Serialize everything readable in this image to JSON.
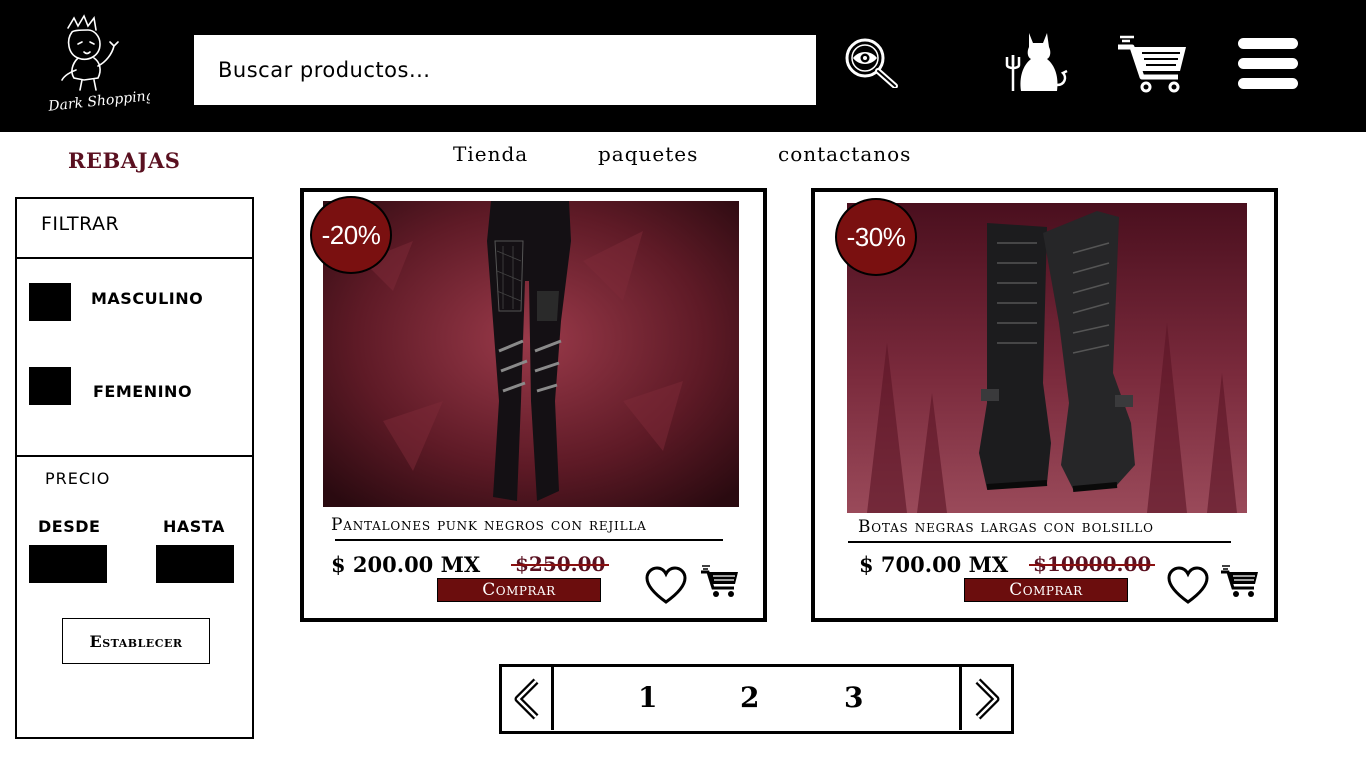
{
  "header": {
    "logo_text": "Dark Shopping",
    "search_placeholder": "Buscar productos...",
    "icons": [
      "search-eye-icon",
      "devil-cat-profile-icon",
      "shopping-cart-icon",
      "hamburger-menu-icon"
    ]
  },
  "nav": {
    "sale_label": "REBAJAS",
    "items": [
      "Tienda",
      "paquetes",
      "contactanos"
    ]
  },
  "filter": {
    "title": "FILTRAR",
    "gender_options": [
      "MASCULINO",
      "FEMENINO"
    ],
    "price_title": "PRECIO",
    "from_label": "DESDE",
    "to_label": "HASTA",
    "apply_label": "Establecer"
  },
  "products": [
    {
      "discount": "-20%",
      "name": "Pantalones punk negros con rejilla",
      "price": "$ 200.00 MX",
      "old_price": "$250.00",
      "buy_label": "Comprar",
      "image": "black-punk-pants-image"
    },
    {
      "discount": "-30%",
      "name": "Botas negras  largas con bolsillo",
      "price": "$ 700.00 MX",
      "old_price": "$10000.00",
      "buy_label": "Comprar",
      "image": "black-long-boots-image"
    }
  ],
  "pagination": {
    "pages": [
      "1",
      "2",
      "3"
    ],
    "icons": [
      "chevron-left-icon",
      "chevron-right-icon"
    ]
  },
  "colors": {
    "header_bg": "#000000",
    "accent": "#6b0d0d",
    "sale_text": "#5a1020",
    "badge": "#7a1010"
  }
}
